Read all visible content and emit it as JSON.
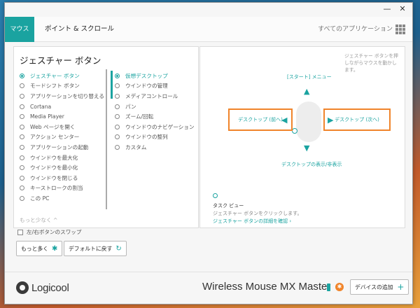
{
  "tabs": {
    "mouse": "マウス",
    "point_scroll": "ポイント & スクロール",
    "all_apps": "すべてのアプリケーション"
  },
  "left_panel": {
    "title": "ジェスチャー ボタン",
    "buttons": [
      {
        "label": "ジェスチャー ボタン",
        "selected": true
      },
      {
        "label": "モードシフト ボタン",
        "selected": false
      },
      {
        "label": "アプリケーションを切り替える",
        "selected": false
      },
      {
        "label": "Cortana",
        "selected": false
      },
      {
        "label": "Media Player",
        "selected": false
      },
      {
        "label": "Web ページを開く",
        "selected": false
      },
      {
        "label": "アクション センター",
        "selected": false
      },
      {
        "label": "アプリケーションの起動",
        "selected": false
      },
      {
        "label": "ウインドウを最大化",
        "selected": false
      },
      {
        "label": "ウインドウを最小化",
        "selected": false
      },
      {
        "label": "ウインドウを閉じる",
        "selected": false
      },
      {
        "label": "キーストロークの割当",
        "selected": false
      },
      {
        "label": "この PC",
        "selected": false
      }
    ],
    "actions": [
      {
        "label": "仮想デスクトップ",
        "selected": true
      },
      {
        "label": "ウインドウの管理",
        "selected": false
      },
      {
        "label": "メディアコントロール",
        "selected": false
      },
      {
        "label": "パン",
        "selected": false
      },
      {
        "label": "ズーム/回転",
        "selected": false
      },
      {
        "label": "ウインドウのナビゲーション",
        "selected": false
      },
      {
        "label": "ウインドウの整列",
        "selected": false
      },
      {
        "label": "カスタム",
        "selected": false
      }
    ],
    "less_label": "もっと少なく ^"
  },
  "swap_buttons_label": "左/右ボタンのスワップ",
  "more_button": "もっと多く",
  "default_button": "デフォルトに戻す",
  "right_panel": {
    "hint": "ジェスチャー ボタンを押しながらマウスを動かします。",
    "up_label": "[スタート] メニュー",
    "left_label": "デスクトップ (前へ)",
    "right_label": "デスクトップ (次へ)",
    "down_label": "デスクトップの表示/非表示",
    "task_title": "タスク ビュー",
    "task_desc": "ジェスチャー ボタンをクリックします。",
    "task_link": "ジェスチャー ボタンの詳細を確認 ›"
  },
  "footer": {
    "logo": "Logicool",
    "device_name": "Wireless Mouse MX Master",
    "add_device": "デバイスの追加"
  },
  "colors": {
    "accent": "#1aa3a0",
    "highlight": "#f0842a"
  },
  "icons": {
    "minimize": "minimize-icon",
    "close": "close-icon",
    "apps_grid": "apps-grid-icon",
    "gear": "gear-icon",
    "reset": "reset-icon",
    "plus": "plus-icon",
    "battery": "battery-icon",
    "unifying": "unifying-icon"
  }
}
